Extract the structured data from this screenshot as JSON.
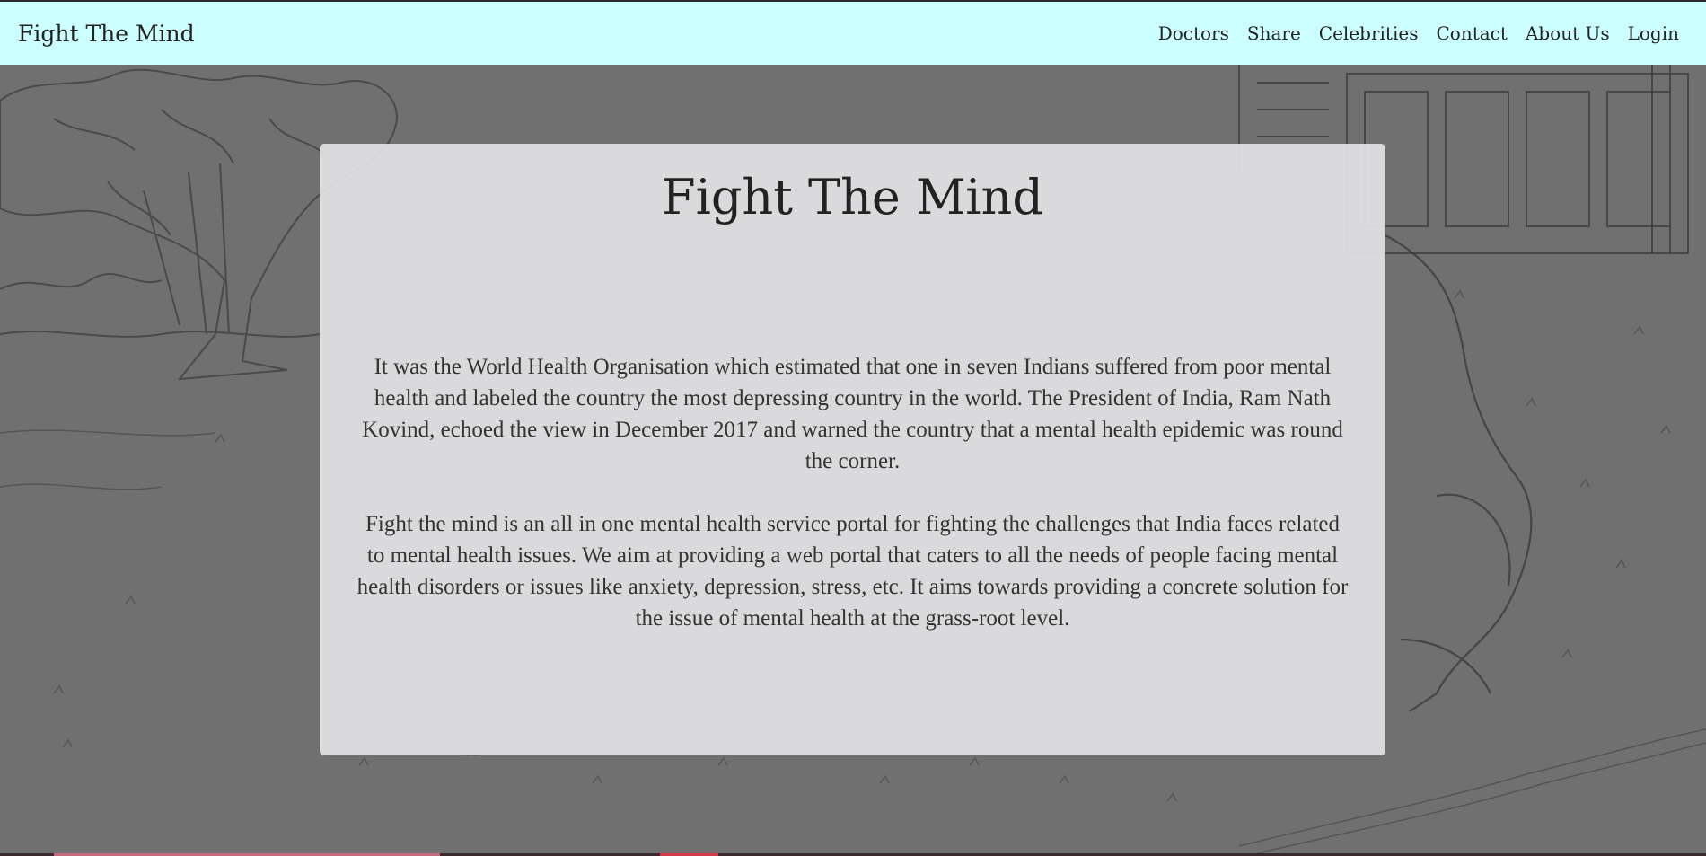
{
  "navbar": {
    "brand": "Fight The Mind",
    "links": [
      "Doctors",
      "Share",
      "Celebrities",
      "Contact",
      "About Us",
      "Login"
    ],
    "background_color": "#ccffff"
  },
  "hero": {
    "background_description_icon": "sketch-people-on-grass-illustration",
    "card": {
      "title": "Fight The Mind",
      "paragraphs": [
        "It was the World Health Organisation which estimated that one in seven Indians suffered from poor mental health and labeled the country the most depressing country in the world. The President of India, Ram Nath Kovind, echoed the view in December 2017 and warned the country that a mental health epidemic was round the corner.",
        "Fight the mind is an all in one mental health service portal for fighting the challenges that India faces related to mental health issues. We aim at providing a web portal that caters to all the needs of people facing mental health disorders or issues like anxiety, depression, stress, etc. It aims towards providing a concrete solution for the issue of mental health at the grass-root level."
      ]
    }
  }
}
